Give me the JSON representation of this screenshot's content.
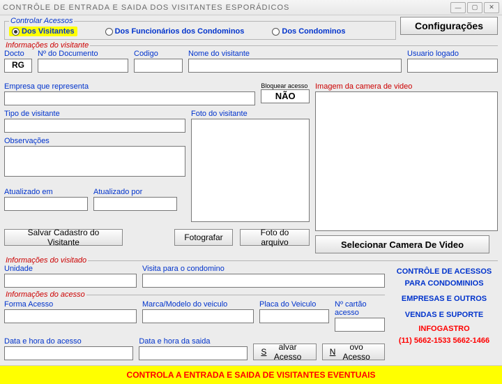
{
  "window": {
    "title": "CONTRÔLE DE ENTRADA E SAIDA DOS VISITANTES ESPORÁDICOS"
  },
  "access_group": {
    "legend": "Controlar Acessos",
    "opt_visitantes": "Dos Visitantes",
    "opt_funcionarios": "Dos Funcionários dos Condominos",
    "opt_condominos": "Dos Condominos"
  },
  "config_btn": "Configurações",
  "visitor_legend": "Informações do visitante",
  "docto_lbl": "Docto",
  "docto_val": "RG",
  "numdoc_lbl": "Nº do Documento",
  "codigo_lbl": "Codigo",
  "nome_lbl": "Nome do visitante",
  "usuario_lbl": "Usuario logado",
  "empresa_lbl": "Empresa que representa",
  "bloquear_lbl": "Bloquear acesso",
  "bloquear_val": "NÃO",
  "camera_lbl": "Imagem da camera de video",
  "tipo_lbl": "Tipo de visitante",
  "foto_lbl": "Foto do visitante",
  "obs_lbl": "Observações",
  "atualizado_em_lbl": "Atualizado em",
  "atualizado_por_lbl": "Atualizado por",
  "btn_salvar_visit": "Salvar Cadastro do Visitante",
  "btn_fotografar": "Fotografar",
  "btn_foto_arquivo": "Foto do arquivo",
  "btn_sel_camera": "Selecionar  Camera  De  Video",
  "visitado_legend": "Informações do visitado",
  "unidade_lbl": "Unidade",
  "visita_para_lbl": "Visita para o condomino",
  "acesso_legend": "Informações do acesso",
  "forma_lbl": "Forma Acesso",
  "marca_lbl": "Marca/Modelo do veiculo",
  "placa_lbl": "Placa do Veiculo",
  "cartao_lbl": "Nº cartão acesso",
  "data_acesso_lbl": "Data e hora do acesso",
  "data_saida_lbl": "Data e hora da saida",
  "btn_salvar_acesso": "Salvar Acesso",
  "btn_novo_acesso": "Novo Acesso",
  "company": {
    "line1": "CONTRÔLE DE ACESSOS",
    "line2": "PARA CONDOMINIOS",
    "line3": "EMPRESAS  E OUTROS",
    "line4": "VENDAS E SUPORTE",
    "line5": "INFOGASTRO",
    "line6": "(11) 5662-1533  5662-1466"
  },
  "footer": "CONTROLA A ENTRADA E SAIDA DE VISITANTES EVENTUAIS"
}
